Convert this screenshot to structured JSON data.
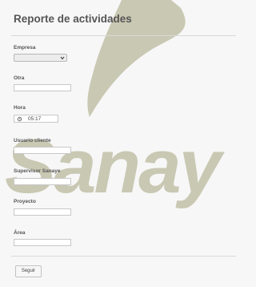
{
  "form": {
    "title": "Reporte de actividades",
    "fields": {
      "empresa": {
        "label": "Empresa",
        "value": ""
      },
      "otra": {
        "label": "Otra",
        "value": ""
      },
      "hora": {
        "label": "Hora",
        "value": "05:17"
      },
      "usuario_cliente": {
        "label": "Usuario cliente",
        "value": ""
      },
      "supervisor": {
        "label": "Supervisor Sanaye",
        "value": ""
      },
      "proyecto": {
        "label": "Proyecto",
        "value": ""
      },
      "area": {
        "label": "Área",
        "value": ""
      }
    },
    "submit_label": "Seguir"
  },
  "watermark": {
    "text": "Sanay"
  },
  "colors": {
    "watermark": "#c9c8b3",
    "background": "#f7f7f7"
  },
  "icons": {
    "time": "clock-icon",
    "select": "chevron-down-icon"
  }
}
